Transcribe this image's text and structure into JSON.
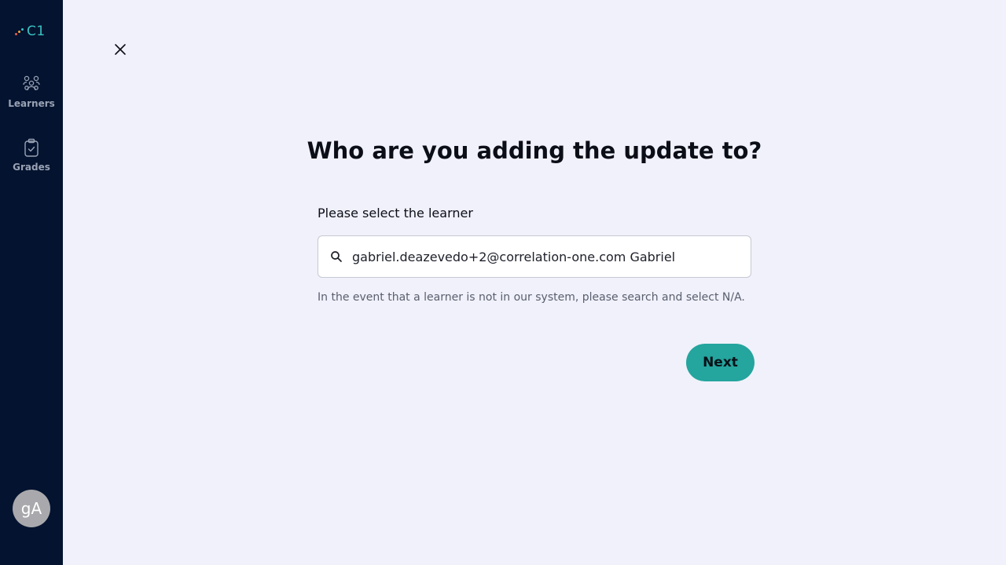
{
  "brand": {
    "logo_text": "C1",
    "logo_colors": [
      "#e85a4f",
      "#f2a541",
      "#39c2c3"
    ]
  },
  "sidebar": {
    "items": [
      {
        "label": "Learners",
        "icon": "learners-icon"
      },
      {
        "label": "Grades",
        "icon": "clipboard-check-icon"
      }
    ],
    "avatar_initials": "gA"
  },
  "dialog": {
    "close_icon": "close-icon",
    "title": "Who are you adding the update to?",
    "field_label": "Please select the learner",
    "search": {
      "icon": "search-icon",
      "value": "gabriel.deazevedo+2@correlation-one.com Gabriel"
    },
    "helper_text": "In the event that a learner is not in our system, please search and select N/A.",
    "next_label": "Next"
  },
  "colors": {
    "sidebar_bg": "#04132f",
    "page_bg": "#f0f1fa",
    "accent": "#24a59e"
  }
}
